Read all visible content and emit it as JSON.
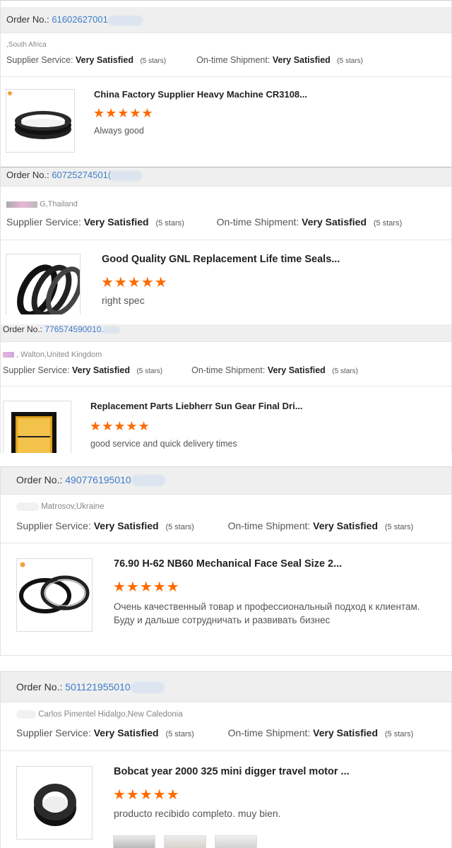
{
  "labels": {
    "order_no": "Order No.:",
    "supplier_service": "Supplier Service:",
    "ontime_shipment": "On-time Shipment:",
    "very_satisfied": "Very Satisfied",
    "five_stars": "(5 stars)"
  },
  "stars": "★★★★★",
  "colors": {
    "accent_orange": "#ff6a00",
    "link_blue": "#3d7cc9",
    "bar_gray": "#efefef"
  },
  "reviews": [
    {
      "order_number": "61602627001",
      "buyer": ",South Africa",
      "product_title": "China Factory Supplier Heavy Machine CR3108...",
      "rating": 5,
      "comment": "Always good"
    },
    {
      "order_number": "60725274501(",
      "buyer": "G,Thailand",
      "product_title": "Good Quality GNL Replacement Life time Seals...",
      "rating": 5,
      "comment": "right spec"
    },
    {
      "order_number": "776574590010.",
      "buyer": ", Walton,United Kingdom",
      "product_title": "Replacement Parts Liebherr Sun Gear Final Dri...",
      "rating": 5,
      "comment": "good service and quick delivery times"
    },
    {
      "order_number": "490776195010",
      "buyer": "Matrosov,Ukraine",
      "product_title": "76.90 H-62 NB60 Mechanical Face Seal Size 2...",
      "rating": 5,
      "comment_line1": "Очень качественный товар и профессиональный подход к клиентам.",
      "comment_line2": "Буду и дальше сотрудничать и развивать бизнес"
    },
    {
      "order_number": "501121955010",
      "buyer": "Carlos Pimentel Hidalgo,New Caledonia",
      "product_title": "Bobcat year 2000 325 mini digger travel motor ...",
      "rating": 5,
      "comment": "producto recibido completo. muy bien."
    }
  ]
}
